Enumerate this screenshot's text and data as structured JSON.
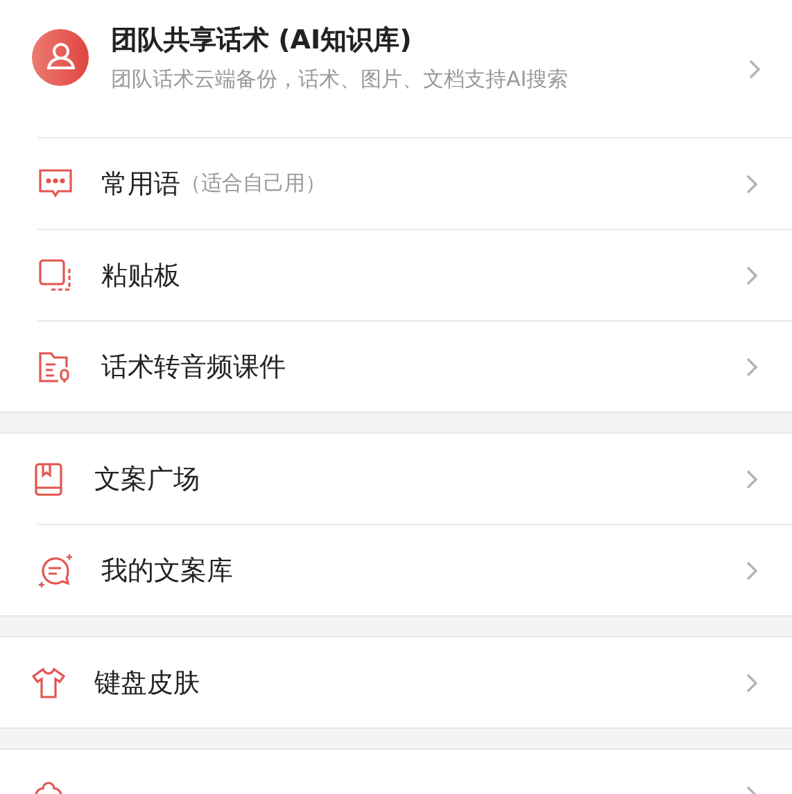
{
  "header": {
    "title": "团队共享话术 (AI知识库)",
    "subtitle": "团队话术云端备份，话术、图片、文档支持AI搜索"
  },
  "sections": [
    {
      "items": [
        {
          "kind": "row",
          "label": "常用语",
          "note": "（适合自己用）"
        },
        {
          "kind": "row",
          "label": "粘贴板"
        },
        {
          "kind": "row",
          "label": "话术转音频课件"
        }
      ]
    },
    {
      "items": [
        {
          "kind": "row",
          "label": "文案广场"
        },
        {
          "kind": "row",
          "label": "我的文案库"
        }
      ]
    },
    {
      "items": [
        {
          "kind": "row",
          "label": "键盘皮肤"
        }
      ]
    },
    {
      "items": [
        {
          "kind": "cut"
        }
      ]
    }
  ]
}
